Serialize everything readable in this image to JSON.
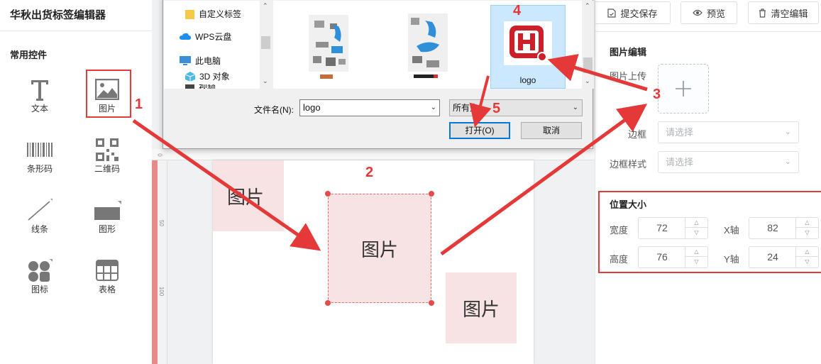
{
  "app": {
    "title": "华秋出货标签编辑器"
  },
  "toolbar": {
    "submit_label": "提交保存",
    "preview_label": "预览",
    "clear_label": "清空编辑"
  },
  "left_panel": {
    "section_title": "常用控件",
    "controls": [
      {
        "label": "文本",
        "icon": "text-icon"
      },
      {
        "label": "图片",
        "icon": "image-icon"
      },
      {
        "label": "条形码",
        "icon": "barcode-icon"
      },
      {
        "label": "二维码",
        "icon": "qrcode-icon"
      },
      {
        "label": "线条",
        "icon": "line-icon"
      },
      {
        "label": "图形",
        "icon": "shape-icon"
      },
      {
        "label": "图标",
        "icon": "icons-icon"
      },
      {
        "label": "表格",
        "icon": "table-icon"
      }
    ]
  },
  "canvas": {
    "ruler_marks": [
      "0",
      "50",
      "100"
    ],
    "images": [
      {
        "label": "图片"
      },
      {
        "label": "图片"
      },
      {
        "label": "图片"
      }
    ]
  },
  "file_dialog": {
    "nav_items": [
      {
        "label": "自定义标签",
        "icon": "folder-icon"
      },
      {
        "label": "WPS云盘",
        "icon": "cloud-icon"
      },
      {
        "label": "此电脑",
        "icon": "computer-icon"
      },
      {
        "label": "3D 对象",
        "icon": "3d-objects-icon"
      },
      {
        "label": "视频",
        "icon": "video-icon"
      }
    ],
    "files": [
      {
        "label": "",
        "icon": "image-file-icon"
      },
      {
        "label": "",
        "icon": "image-file-icon"
      },
      {
        "label": "logo",
        "icon": "logo-file-icon"
      }
    ],
    "filename_label": "文件名(N):",
    "filename_value": "logo",
    "filetype_value": "所有文",
    "open_label": "打开(O)",
    "cancel_label": "取消"
  },
  "right_panel": {
    "image_edit_title": "图片编辑",
    "upload_label": "图片上传",
    "border_label": "边框",
    "border_placeholder": "请选择",
    "border_style_label": "边框样式",
    "border_style_placeholder": "请选择",
    "position_title": "位置大小",
    "width_label": "宽度",
    "width_value": "72",
    "x_label": "X轴",
    "x_value": "82",
    "height_label": "高度",
    "height_value": "76",
    "y_label": "Y轴",
    "y_value": "24"
  },
  "annotations": {
    "step1": "1",
    "step2": "2",
    "step3": "3",
    "step4": "4",
    "step5": "5"
  },
  "colors": {
    "accent_red": "#e53838",
    "image_fill": "#f8e3e4",
    "selection_blue": "#cce8ff"
  }
}
